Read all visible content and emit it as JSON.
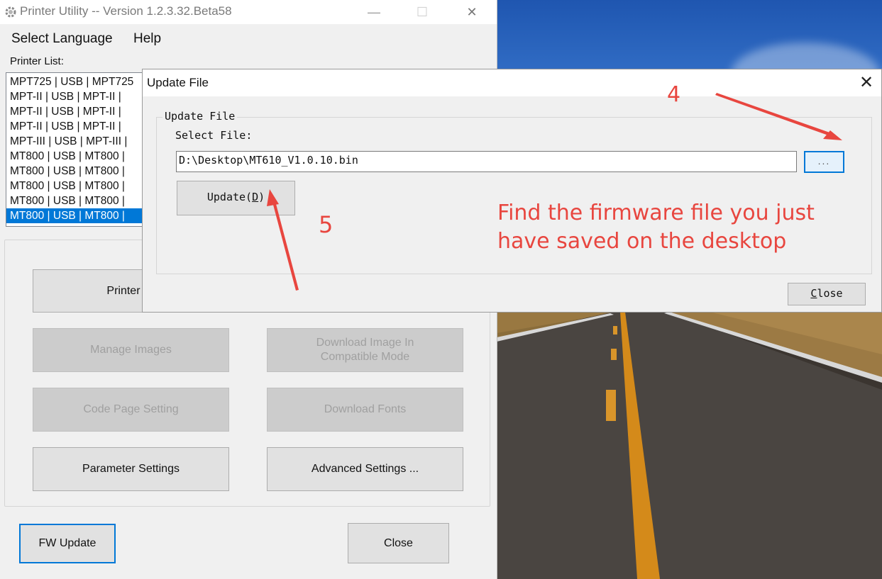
{
  "main_window": {
    "title": "Printer Utility -- Version 1.2.3.32.Beta58",
    "controls": {
      "minimize": "—",
      "maximize": "☐",
      "close": "✕"
    },
    "menu": [
      "Select Language",
      "Help"
    ],
    "printer_list_label": "Printer List:",
    "printers": [
      "MPT725 | USB | MPT725",
      "MPT-II | USB | MPT-II |",
      "MPT-II | USB | MPT-II |",
      "MPT-II | USB | MPT-II |",
      "MPT-III | USB | MPT-III |",
      "MT800 | USB | MT800 |",
      "MT800 | USB | MT800 |",
      "MT800 | USB | MT800 |",
      "MT800 | USB | MT800 |",
      "MT800 | USB | MT800 |"
    ],
    "selected_printer_index": 9,
    "buttons": {
      "printer_test": "Printer Te",
      "manage_images": "Manage Images",
      "download_image_compat": "Download Image In Compatible Mode",
      "code_page_setting": "Code Page Setting",
      "download_fonts": "Download Fonts",
      "parameter_settings": "Parameter Settings",
      "advanced_settings": "Advanced Settings ...",
      "fw_update": "FW Update",
      "close": "Close"
    }
  },
  "update_dialog": {
    "title": "Update File",
    "close_glyph": "✕",
    "group_label": "Update File",
    "select_file_label": "Select File:",
    "file_path": "D:\\Desktop\\MT610_V1.0.10.bin",
    "browse_label": "...",
    "update_button": {
      "prefix": "Update(",
      "mnemonic": "D",
      "suffix": ")"
    },
    "close_button": {
      "mnemonic": "C",
      "rest": "lose"
    }
  },
  "annotations": {
    "step4": "4",
    "step5": "5",
    "instruction_line1": "Find the firmware file you just",
    "instruction_line2": "have saved on the desktop",
    "color": "#e8463f"
  }
}
